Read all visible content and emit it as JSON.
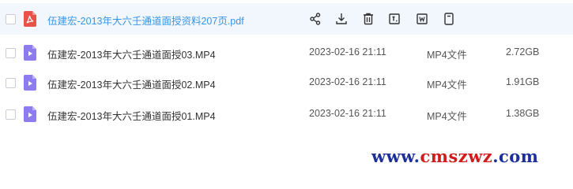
{
  "files": [
    {
      "name": "伍建宏-2013年大六壬通道面授资料207页.pdf",
      "kind": "pdf",
      "hovered": true
    },
    {
      "name": "伍建宏-2013年大六壬通道面授03.MP4",
      "date": "2023-02-16 21:11",
      "type": "MP4文件",
      "size": "2.72GB",
      "kind": "video"
    },
    {
      "name": "伍建宏-2013年大六壬通道面授02.MP4",
      "date": "2023-02-16 21:11",
      "type": "MP4文件",
      "size": "1.91GB",
      "kind": "video"
    },
    {
      "name": "伍建宏-2013年大六壬通道面授01.MP4",
      "date": "2023-02-16 21:11",
      "type": "MP4文件",
      "size": "1.38GB",
      "kind": "video"
    }
  ],
  "row_actions": [
    "share-icon",
    "download-icon",
    "delete-icon",
    "rename-icon",
    "copy-icon",
    "more-icon"
  ],
  "watermark": {
    "part1": "www.",
    "part2": "cmszwz",
    "part3": ".com"
  },
  "colors": {
    "accent": "#3a95e6",
    "pdf": "#e8524a",
    "video": "#8c7cf0",
    "hover_bg": "#f2f6fd"
  }
}
